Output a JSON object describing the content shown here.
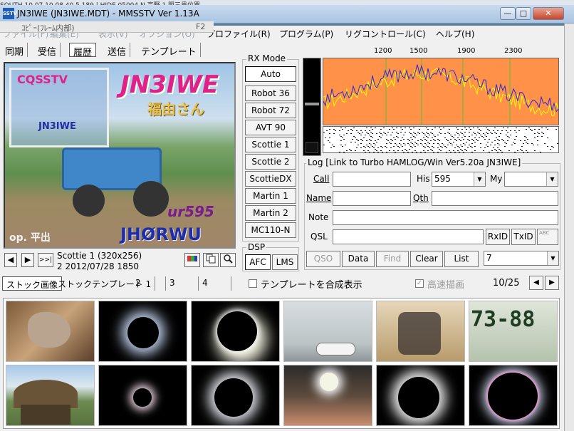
{
  "background_strip": "SOUTH 10 07 10 08 40 5    189 | HIDE    05004    N    高野    1 照三貴位置",
  "window": {
    "title": "JN3IWE (JN3IWE.MDT) - MMSSTV Ver 1.13A",
    "app_icon": "SSTV"
  },
  "overlay": {
    "left": "ｺﾋﾟｰ(ﾌﾚｰﾑ内部)",
    "right": "F2"
  },
  "menu": [
    "ファイル(F)",
    "編集(E)",
    "表示(V)",
    "オプション(O)",
    "プロファイル(R)",
    "プログラム(P)",
    "リグコントロール(C)",
    "ヘルプ(H)"
  ],
  "tabs": [
    "同期",
    "受信",
    "履歴",
    "送信",
    "テンプレート"
  ],
  "rx_image": {
    "call": "JN3IWE",
    "name": "福由さん",
    "cq": "CQSSTV",
    "small_call": "JN3IWE",
    "rst": "ur595",
    "op": "op. 平出",
    "dxcall": "JHØRWU"
  },
  "image_info": {
    "mode": "Scottie 1 (320x256)",
    "date": "2 2012/07/28 1850"
  },
  "rx_mode": {
    "title": "RX Mode",
    "buttons": [
      "Auto",
      "Robot 36",
      "Robot 72",
      "AVT 90",
      "Scottie 1",
      "Scottie 2",
      "ScottieDX",
      "Martin 1",
      "Martin 2",
      "MC110-N"
    ],
    "active": "Auto"
  },
  "dsp": {
    "title": "DSP",
    "afc": "AFC",
    "lms": "LMS"
  },
  "spectrum": {
    "freq_labels": [
      "1200",
      "1500",
      "1900",
      "2300"
    ]
  },
  "level_meter": {
    "value": 0.12
  },
  "log": {
    "title": "Log [Link to Turbo HAMLOG/Win Ver5.20a  JN3IWE]",
    "call_label": "Call",
    "call_value": "",
    "his_label": "His",
    "his_value": "595",
    "my_label": "My",
    "my_value": "",
    "name_label": "Name",
    "name_value": "",
    "qth_label": "Qth",
    "qth_value": "",
    "note_label": "Note",
    "note_value": "",
    "qsl_label": "QSL",
    "qsl_value": "",
    "rxid": "RxID",
    "txid": "TxID",
    "abc": "ABC",
    "qso_btn": "QSO",
    "data_btn": "Data",
    "find_btn": "Find",
    "clear_btn": "Clear",
    "list_btn": "List",
    "list_value": "7"
  },
  "bottom_tabs": [
    "ストック画像",
    "ストックテンプレート 1",
    "2",
    "3",
    "4"
  ],
  "template_composite": "テンプレートを合成表示",
  "fast_draw": "高速描画",
  "page_counter": "10/25",
  "nav": {
    "prev": "◀",
    "next": "▶",
    "last": ">>|"
  },
  "tool_icons": [
    "palette-icon",
    "copy-icon",
    "zoom-icon"
  ],
  "thumb_texts": {
    "plate": "73-88"
  }
}
